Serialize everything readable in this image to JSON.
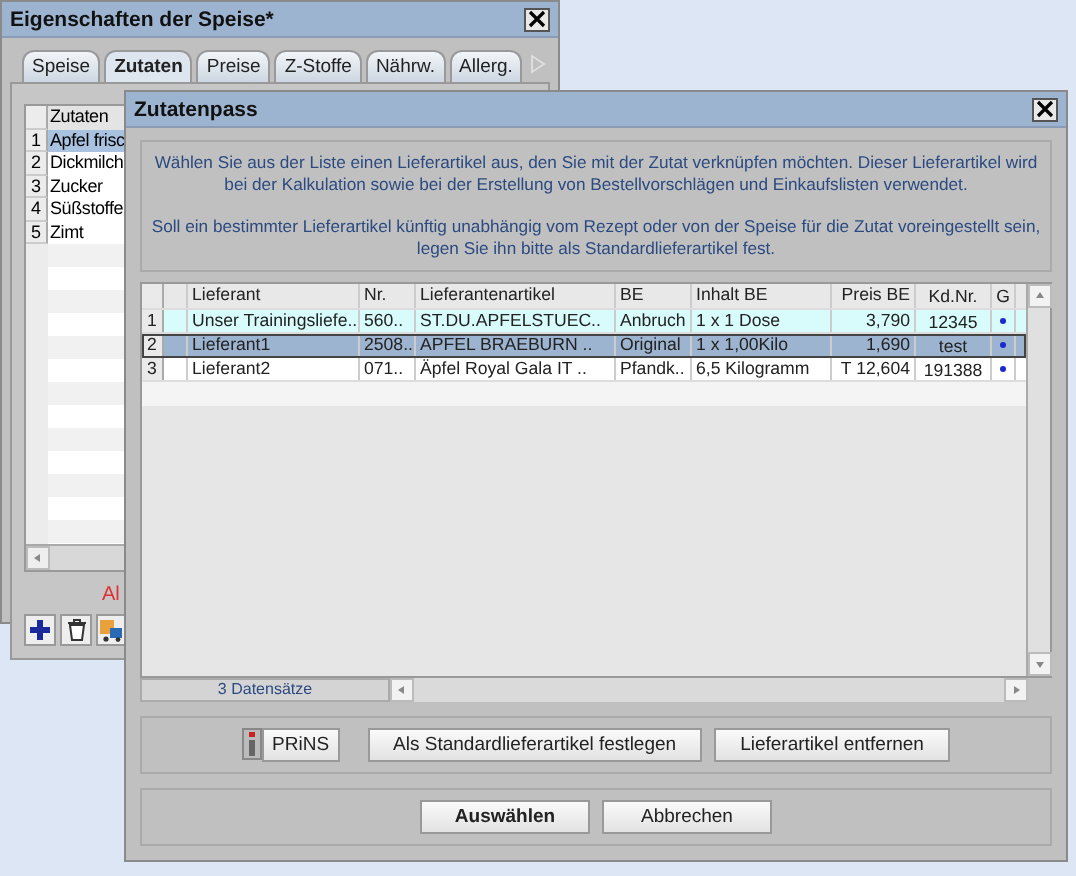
{
  "background_window": {
    "title": "Eigenschaften der Speise*",
    "tabs": [
      {
        "label": "Speise",
        "selected": false
      },
      {
        "label": "Zutaten",
        "selected": true
      },
      {
        "label": "Preise",
        "selected": false
      },
      {
        "label": "Z-Stoffe",
        "selected": false
      },
      {
        "label": "Nährw.",
        "selected": false
      },
      {
        "label": "Allerg.",
        "selected": false
      }
    ],
    "table": {
      "columns": [
        "Zutaten"
      ],
      "rows": [
        {
          "number": "1",
          "name": "Apfel frisc",
          "selected": true
        },
        {
          "number": "2",
          "name": "Dickmilch",
          "selected": false
        },
        {
          "number": "3",
          "name": "Zucker",
          "selected": false
        },
        {
          "number": "4",
          "name": "Süßstoffe",
          "selected": false
        },
        {
          "number": "5",
          "name": "Zimt",
          "selected": false
        }
      ]
    },
    "status_text": "Al"
  },
  "dialog": {
    "title": "Zutatenpass",
    "info": [
      "Wählen Sie aus der Liste einen Lieferartikel aus, den Sie mit der Zutat verknüpfen möchten. Dieser Lieferartikel wird bei der Kalkulation sowie bei der Erstellung von Bestellvorschlägen und Einkaufslisten verwendet.",
      "Soll ein bestimmter Lieferartikel künftig unabhängig vom Rezept oder von der Speise für die Zutat voreingestellt sein, legen Sie ihn bitte als Standardlieferartikel fest."
    ],
    "table": {
      "columns": [
        "Lieferant",
        "Nr.",
        "Lieferantenartikel",
        "BE",
        "Inhalt BE",
        "Preis BE",
        "Kd.Nr.",
        "G"
      ],
      "rows": [
        {
          "number": "1",
          "cells": [
            "Unser Trainingsliefe..",
            "560..",
            "ST.DU.APFELSTUEC..",
            "Anbruch",
            "1 x 1 Dose",
            "3,790",
            "12345"
          ],
          "g_flag": true,
          "highlighted": true,
          "selected": false
        },
        {
          "number": "2",
          "cells": [
            "Lieferant1",
            "2508..",
            "APFEL BRAEBURN ..",
            "Original",
            "1 x 1,00Kilo",
            "1,690",
            "test"
          ],
          "g_flag": true,
          "highlighted": false,
          "selected": true
        },
        {
          "number": "3",
          "cells": [
            "Lieferant2",
            "071..",
            "Äpfel Royal Gala IT ..",
            "Pfandk..",
            "6,5 Kilogramm",
            "T 12,604",
            "191388"
          ],
          "g_flag": true,
          "highlighted": false,
          "selected": false
        }
      ]
    },
    "record_count": "3 Datensätze",
    "prins_label": "PRiNS",
    "actions": [
      "Als Standardlieferartikel festlegen",
      "Lieferartikel entfernen"
    ],
    "buttons": [
      {
        "label": "Auswählen",
        "default": true
      },
      {
        "label": "Abbrechen",
        "default": false
      }
    ]
  }
}
